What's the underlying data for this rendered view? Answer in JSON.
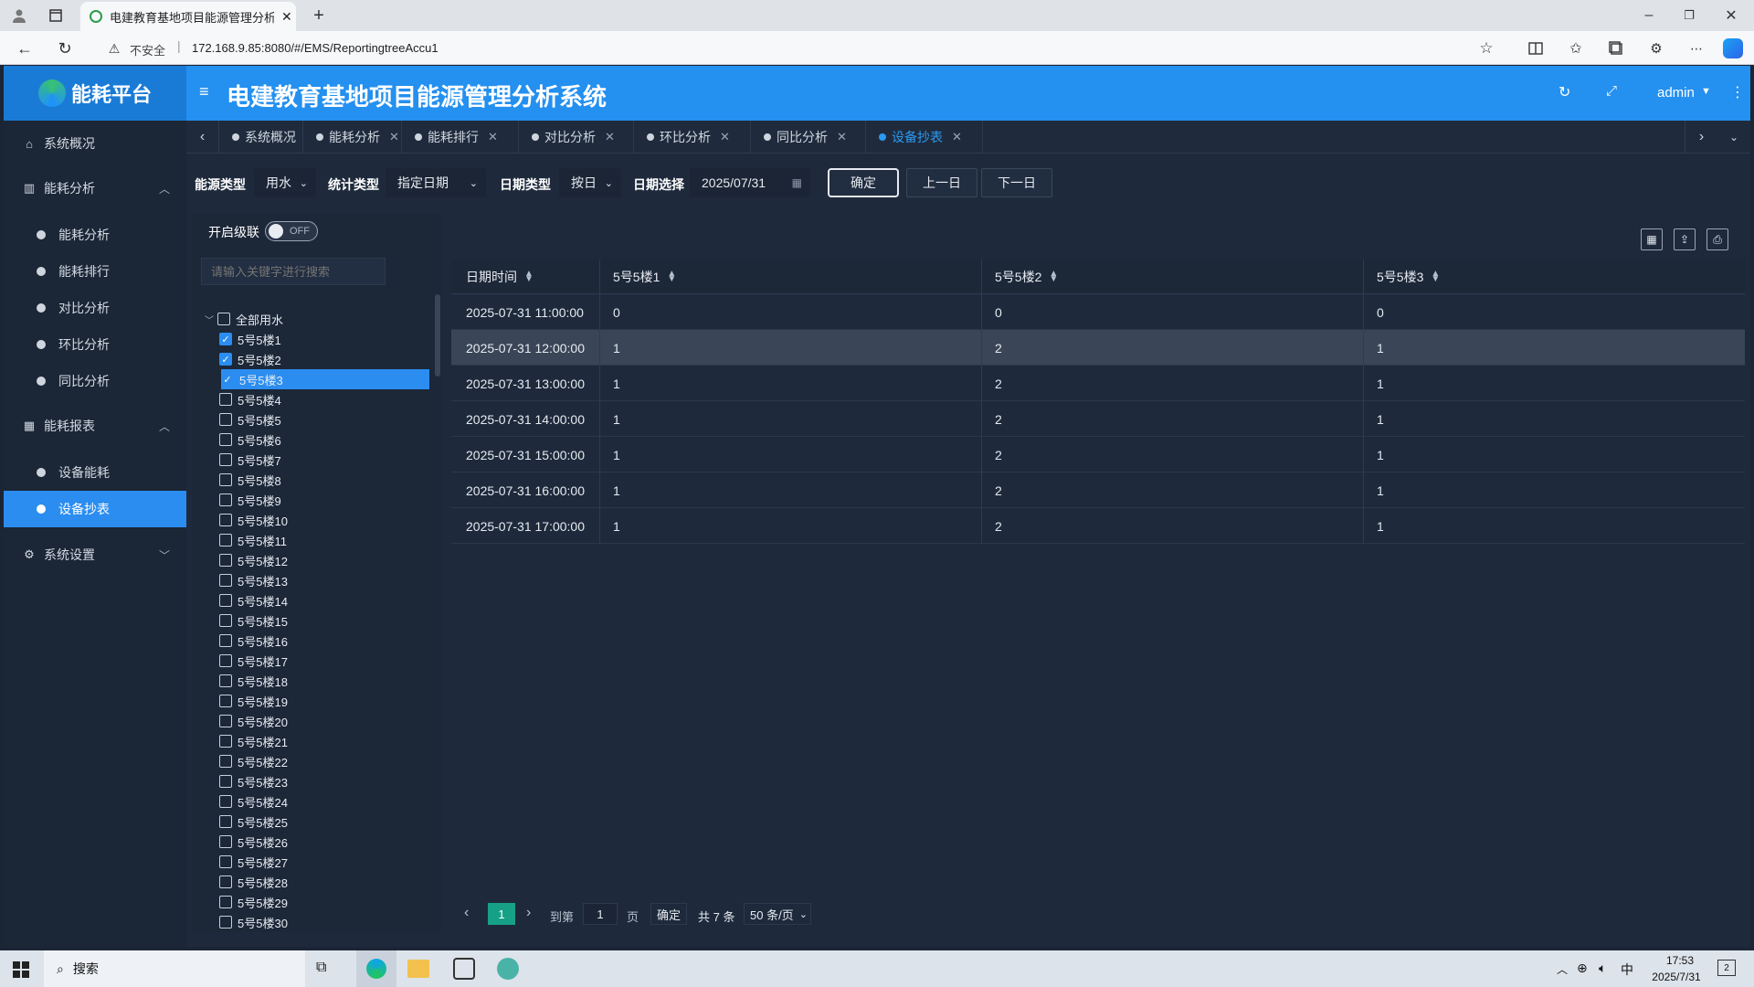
{
  "browser": {
    "tab_title": "电建教育基地项目能源管理分析系",
    "security": "不安全",
    "url": "172.168.9.85:8080/#/EMS/ReportingtreeAccu1"
  },
  "app": {
    "logo_text": "能耗平台",
    "title": "电建教育基地项目能源管理分析系统",
    "user": "admin"
  },
  "nav_tabs": [
    {
      "label": "系统概况",
      "closable": false
    },
    {
      "label": "能耗分析",
      "closable": true
    },
    {
      "label": "能耗排行",
      "closable": true
    },
    {
      "label": "对比分析",
      "closable": true
    },
    {
      "label": "环比分析",
      "closable": true
    },
    {
      "label": "同比分析",
      "closable": true
    },
    {
      "label": "设备抄表",
      "closable": true
    }
  ],
  "sidebar": {
    "overview": "系统概况",
    "group1": {
      "label": "能耗分析",
      "items": [
        "能耗分析",
        "能耗排行",
        "对比分析",
        "环比分析",
        "同比分析"
      ]
    },
    "group2": {
      "label": "能耗报表",
      "items": [
        "设备能耗",
        "设备抄表"
      ]
    },
    "settings": "系统设置"
  },
  "filters": {
    "energy_type_label": "能源类型",
    "energy_type_value": "用水",
    "stat_type_label": "统计类型",
    "stat_type_value": "指定日期",
    "date_type_label": "日期类型",
    "date_type_value": "按日",
    "date_select_label": "日期选择",
    "date_value": "2025/07/31",
    "confirm": "确定",
    "prev": "上一日",
    "next": "下一日"
  },
  "tree": {
    "cascade_label": "开启级联",
    "toggle_text": "OFF",
    "search_placeholder": "请输入关键字进行搜索",
    "root": "全部用水",
    "nodes": [
      "5号5楼1",
      "5号5楼2",
      "5号5楼3",
      "5号5楼4",
      "5号5楼5",
      "5号5楼6",
      "5号5楼7",
      "5号5楼8",
      "5号5楼9",
      "5号5楼10",
      "5号5楼11",
      "5号5楼12",
      "5号5楼13",
      "5号5楼14",
      "5号5楼15",
      "5号5楼16",
      "5号5楼17",
      "5号5楼18",
      "5号5楼19",
      "5号5楼20",
      "5号5楼21",
      "5号5楼22",
      "5号5楼23",
      "5号5楼24",
      "5号5楼25",
      "5号5楼26",
      "5号5楼27",
      "5号5楼28",
      "5号5楼29",
      "5号5楼30"
    ],
    "checked": [
      0,
      1,
      2
    ],
    "selected": 2
  },
  "table": {
    "headers": [
      "日期时间",
      "5号5楼1",
      "5号5楼2",
      "5号5楼3"
    ],
    "rows": [
      [
        "2025-07-31 11:00:00",
        "0",
        "0",
        "0"
      ],
      [
        "2025-07-31 12:00:00",
        "1",
        "2",
        "1"
      ],
      [
        "2025-07-31 13:00:00",
        "1",
        "2",
        "1"
      ],
      [
        "2025-07-31 14:00:00",
        "1",
        "2",
        "1"
      ],
      [
        "2025-07-31 15:00:00",
        "1",
        "2",
        "1"
      ],
      [
        "2025-07-31 16:00:00",
        "1",
        "2",
        "1"
      ],
      [
        "2025-07-31 17:00:00",
        "1",
        "2",
        "1"
      ]
    ],
    "highlight_row": 1
  },
  "pager": {
    "current": "1",
    "goto_label": "到第",
    "page_input": "1",
    "page_unit": "页",
    "confirm": "确定",
    "total": "共 7 条",
    "page_size": "50 条/页"
  },
  "taskbar": {
    "search": "搜索",
    "ime": "中",
    "time": "17:53",
    "date": "2025/7/31",
    "notifications": "2"
  }
}
